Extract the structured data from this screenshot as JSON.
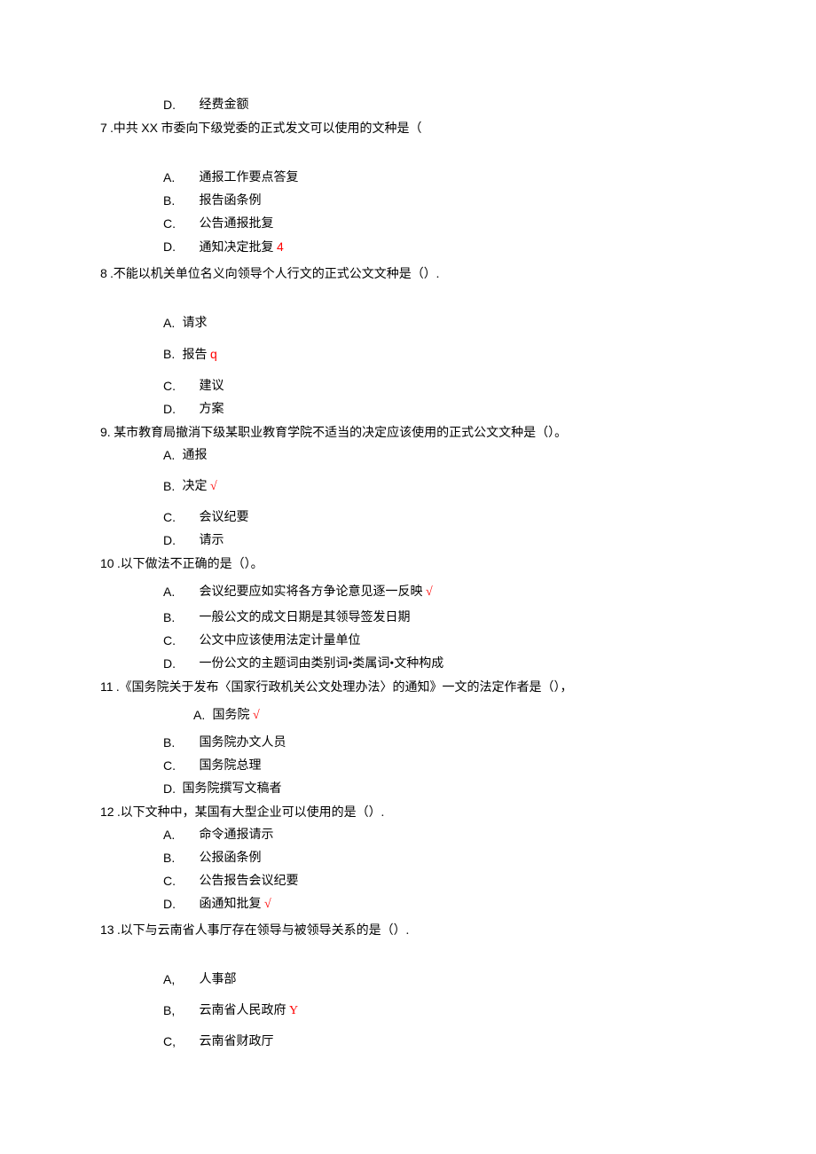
{
  "q6": {
    "optD": {
      "label": "D.",
      "text": "经费金额"
    }
  },
  "q7": {
    "num": "7",
    "stem": " .中共 XX 市委向下级党委的正式发文可以使用的文种是（",
    "A": {
      "label": "A.",
      "text": "通报工作要点答复"
    },
    "B": {
      "label": "B.",
      "text": "报告函条例"
    },
    "C": {
      "label": "C.",
      "text": "公告通报批复"
    },
    "D": {
      "label": "D.",
      "text": "通知决定批复 ",
      "mark": "4"
    }
  },
  "q8": {
    "num": "8",
    "stem": " .不能以机关单位名义向领导个人行文的正式公文文种是（）.",
    "A": {
      "label": "A.",
      "text": "请求"
    },
    "B": {
      "label": "B.",
      "text": "报告 ",
      "mark": "q"
    },
    "C": {
      "label": "C.",
      "text": "建议"
    },
    "D": {
      "label": "D.",
      "text": "方案"
    }
  },
  "q9": {
    "num": "9.",
    "stem": "某市教育局撤消下级某职业教育学院不适当的决定应该使用的正式公文文种是（）。",
    "A": {
      "label": "A.",
      "text": "通报"
    },
    "B": {
      "label": "B.",
      "text": "决定 ",
      "mark": "√"
    },
    "C": {
      "label": "C.",
      "text": "会议纪要"
    },
    "D": {
      "label": "D.",
      "text": "请示"
    }
  },
  "q10": {
    "num": "10",
    "stem": " .以下做法不正确的是（）。",
    "A": {
      "label": "A.",
      "text": "会议纪要应如实将各方争论意见逐一反映 ",
      "mark": "√"
    },
    "B": {
      "label": "B.",
      "text": "一般公文的成文日期是其领导签发日期"
    },
    "C": {
      "label": "C.",
      "text": "公文中应该使用法定计量单位"
    },
    "D": {
      "label": "D.",
      "text": "一份公文的主题词由类别词•类属词•文种构成"
    }
  },
  "q11": {
    "num": "11",
    "stem": " .《国务院关于发布〈国家行政机关公文处理办法〉的通知》一文的法定作者是（），",
    "A": {
      "label": "A.",
      "text": "国务院 ",
      "mark": "√"
    },
    "B": {
      "label": "B.",
      "text": "国务院办文人员"
    },
    "C": {
      "label": "C.",
      "text": "国务院总理"
    },
    "D": {
      "label": "D.",
      "text": "国务院撰写文稿者"
    }
  },
  "q12": {
    "num": "12",
    "stem": " .以下文种中，某国有大型企业可以使用的是（）.",
    "A": {
      "label": "A.",
      "text": "命令通报请示"
    },
    "B": {
      "label": "B.",
      "text": "公报函条例"
    },
    "C": {
      "label": "C.",
      "text": "公告报告会议纪要"
    },
    "D": {
      "label": "D.",
      "text": "函通知批复 ",
      "mark": "√"
    }
  },
  "q13": {
    "num": "13",
    "stem": " .以下与云南省人事厅存在领导与被领导关系的是（）.",
    "A": {
      "label": "A,",
      "text": "人事部"
    },
    "B": {
      "label": "B,",
      "text": "云南省人民政府 ",
      "mark": "Y"
    },
    "C": {
      "label": "C,",
      "text": "云南省财政厅"
    }
  }
}
